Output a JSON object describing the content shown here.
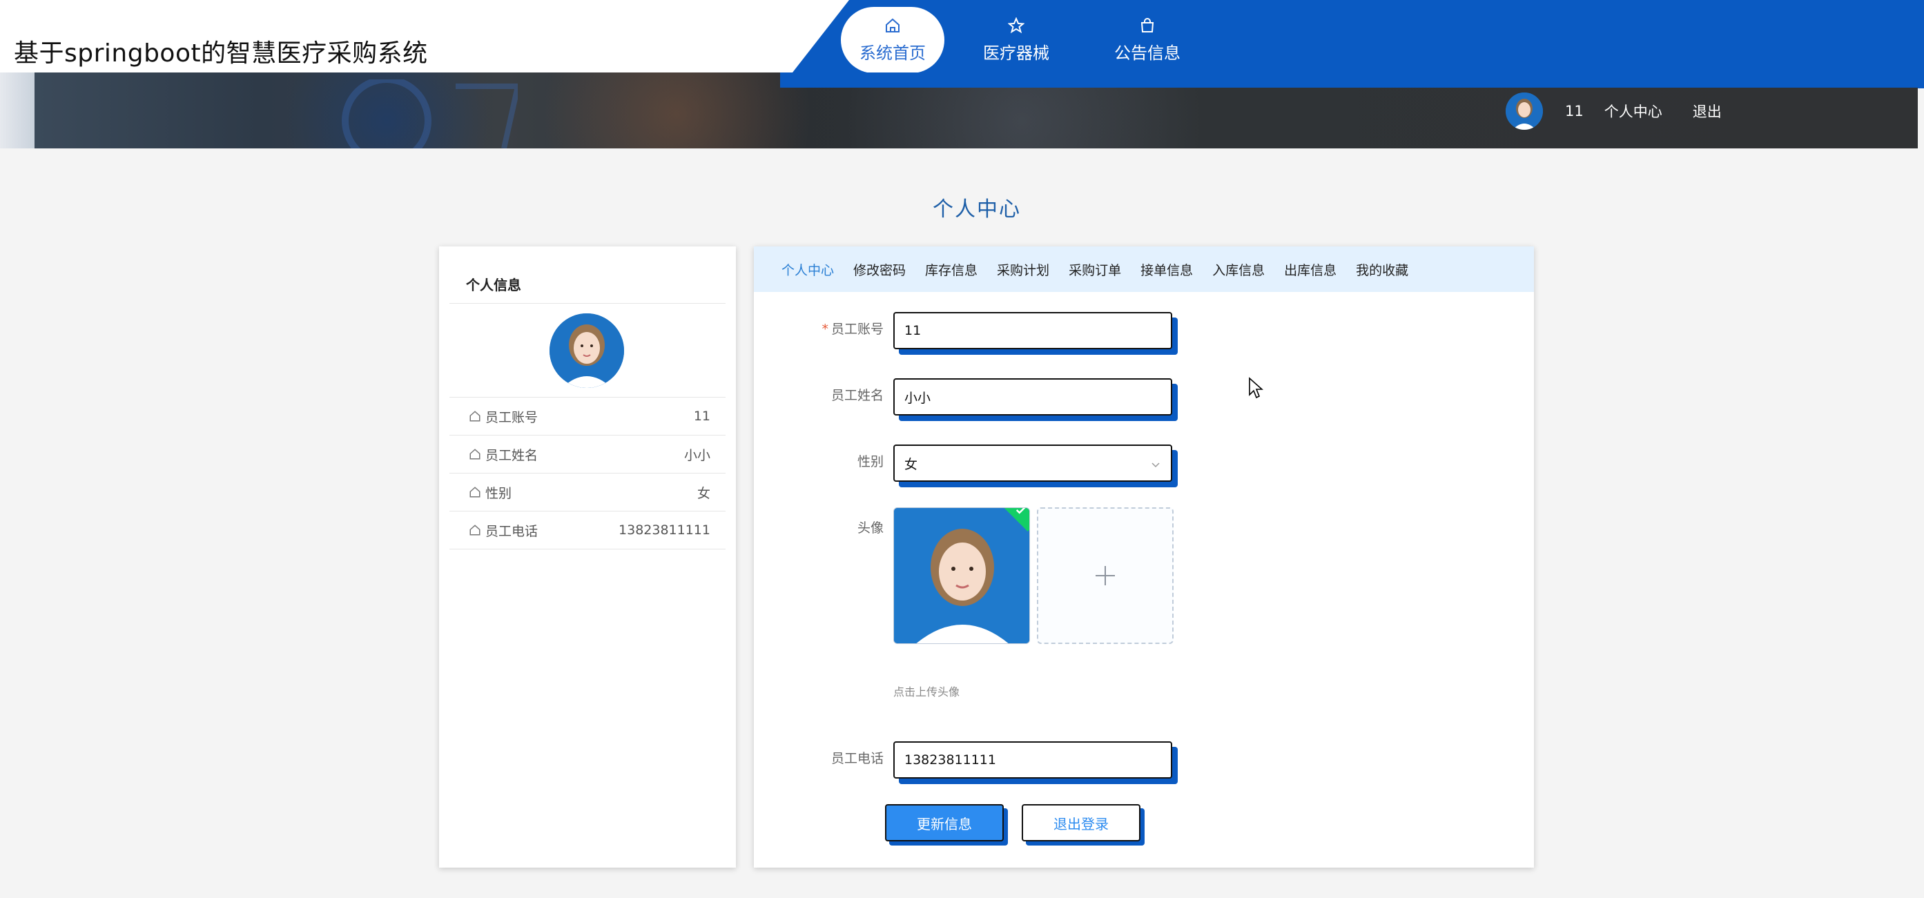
{
  "header": {
    "site_title": "基于springboot的智慧医疗采购系统",
    "nav": [
      {
        "label": "系统首页",
        "icon": "home-icon",
        "active": true
      },
      {
        "label": "医疗器械",
        "icon": "star-icon",
        "active": false
      },
      {
        "label": "公告信息",
        "icon": "bag-icon",
        "active": false
      }
    ],
    "user": {
      "name": "11",
      "center_link": "个人中心",
      "logout_link": "退出"
    }
  },
  "page": {
    "title": "个人中心"
  },
  "left_panel": {
    "heading": "个人信息",
    "rows": [
      {
        "label": "员工账号",
        "value": "11"
      },
      {
        "label": "员工姓名",
        "value": "小小"
      },
      {
        "label": "性别",
        "value": "女"
      },
      {
        "label": "员工电话",
        "value": "13823811111"
      }
    ]
  },
  "tabs": [
    "个人中心",
    "修改密码",
    "库存信息",
    "采购计划",
    "采购订单",
    "接单信息",
    "入库信息",
    "出库信息",
    "我的收藏"
  ],
  "active_tab": "个人中心",
  "form": {
    "account": {
      "label": "员工账号",
      "value": "11",
      "required": true
    },
    "name": {
      "label": "员工姓名",
      "value": "小小"
    },
    "gender": {
      "label": "性别",
      "value": "女"
    },
    "avatar": {
      "label": "头像",
      "hint": "点击上传头像"
    },
    "phone": {
      "label": "员工电话",
      "value": "13823811111"
    },
    "update_button": "更新信息",
    "logout_button": "退出登录"
  },
  "colors": {
    "nav_blue": "#0a5ac2",
    "accent": "#2d8cf0",
    "tab_bg": "#e3f1fe",
    "page_title": "#1e5fa8",
    "success": "#13ce66"
  }
}
